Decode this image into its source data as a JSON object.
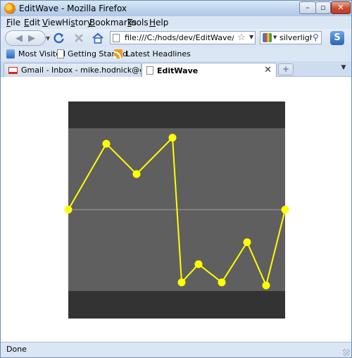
{
  "window": {
    "title": "EditWave - Mozilla Firefox"
  },
  "menu": [
    "File",
    "Edit",
    "View",
    "History",
    "Bookmarks",
    "Tools",
    "Help"
  ],
  "menu_access_keys": [
    "F",
    "E",
    "V",
    "s",
    "B",
    "T",
    "H"
  ],
  "nav": {
    "url": "file:///C:/hods/dev/EditWave/EditWa",
    "search_text": "silverlight p"
  },
  "bookmarks": [
    {
      "label": "Most Visited",
      "icon": "most-visited-icon"
    },
    {
      "label": "Getting Started",
      "icon": "page-icon"
    },
    {
      "label": "Latest Headlines",
      "icon": "rss-icon"
    }
  ],
  "tabs": [
    {
      "label": "Gmail - Inbox - mike.hodnick@gma...",
      "icon": "gmail-icon",
      "active": false
    },
    {
      "label": "EditWave",
      "icon": "page-icon",
      "active": true
    }
  ],
  "status": {
    "text": "Done"
  },
  "colors": {
    "band_dark": "#333333",
    "band_mid": "#5f5f5f",
    "center_line": "#8a8a8a",
    "wave": "#ffff00"
  },
  "wave_editor": {
    "value_range": [
      -1,
      1
    ],
    "points": [
      0,
      0.87,
      0.47,
      0.95,
      -0.96,
      -0.72,
      -0.96,
      -0.43,
      -1,
      0
    ]
  }
}
